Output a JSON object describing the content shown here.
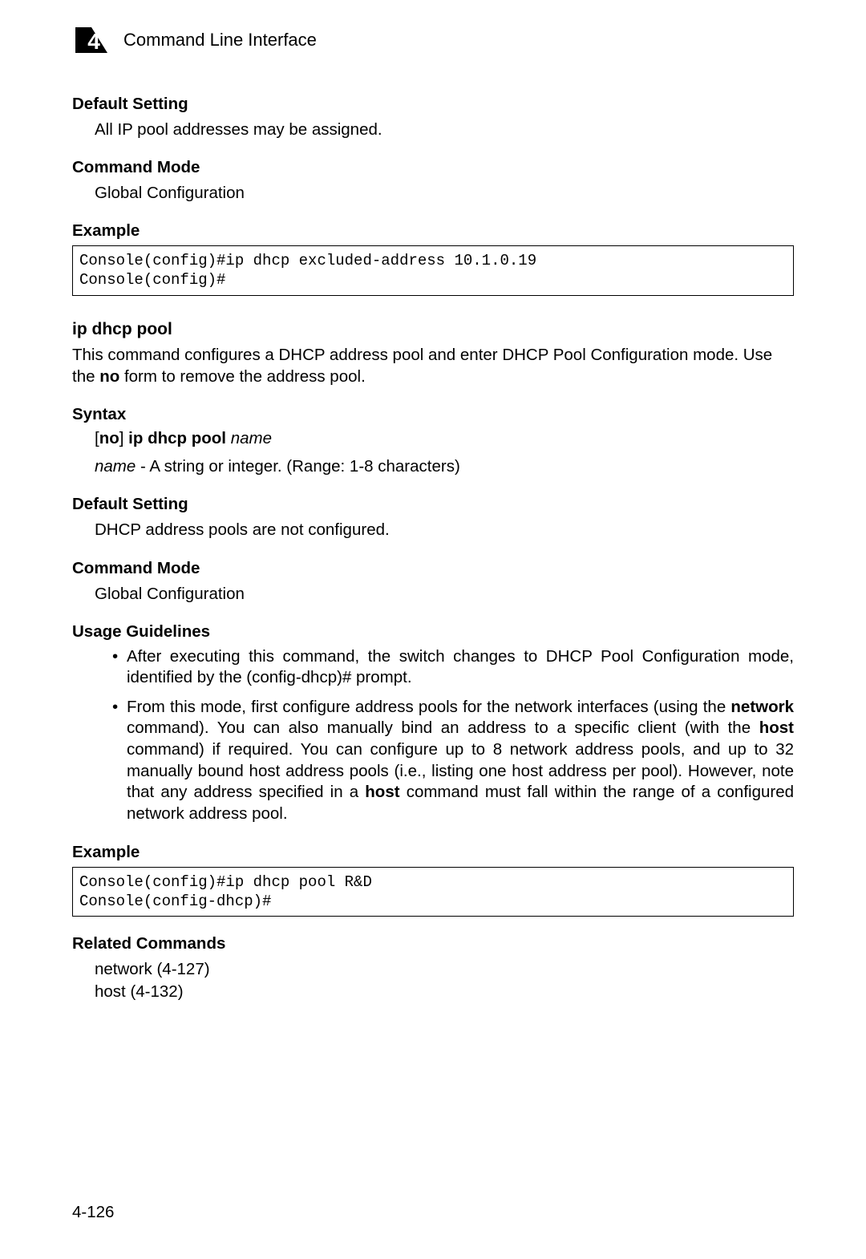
{
  "header": {
    "chapter_number": "4",
    "title": "Command Line Interface"
  },
  "sections": {
    "default_setting_1": {
      "heading": "Default Setting",
      "text": "All IP pool addresses may be assigned."
    },
    "command_mode_1": {
      "heading": "Command Mode",
      "text": "Global Configuration"
    },
    "example_1": {
      "heading": "Example",
      "code": "Console(config)#ip dhcp excluded-address 10.1.0.19\nConsole(config)#"
    },
    "command": {
      "title": "ip dhcp pool",
      "description": "This command configures a DHCP address pool and enter DHCP Pool Configuration mode. Use the ",
      "description_bold": "no",
      "description_after": " form to remove the address pool."
    },
    "syntax": {
      "heading": "Syntax",
      "prefix_bracket_open": "[",
      "prefix_bold": "no",
      "prefix_bracket_close": "] ",
      "cmd_bold": "ip dhcp pool",
      "param_italic": " name",
      "param_name_italic": "name",
      "param_desc": " - A string or integer. (Range: 1-8 characters)"
    },
    "default_setting_2": {
      "heading": "Default Setting",
      "text": "DHCP address pools are not configured."
    },
    "command_mode_2": {
      "heading": "Command Mode",
      "text": "Global Configuration"
    },
    "usage": {
      "heading": "Usage Guidelines",
      "items": [
        {
          "pre": "After executing this command, the switch changes to DHCP Pool Configuration mode, identified by the (config-dhcp)# prompt."
        },
        {
          "parts": [
            {
              "t": "From this mode, first configure address pools for the network interfaces (using the "
            },
            {
              "b": "network"
            },
            {
              "t": " command). You can also manually bind an address to a specific client (with the "
            },
            {
              "b": "host"
            },
            {
              "t": " command) if required. You can configure up to 8 network address pools, and up to 32 manually bound host address pools (i.e., listing one host address per pool). However, note that any address specified in a "
            },
            {
              "b": "host"
            },
            {
              "t": " command must fall within the range of a configured network address pool."
            }
          ]
        }
      ]
    },
    "example_2": {
      "heading": "Example",
      "code": "Console(config)#ip dhcp pool R&D\nConsole(config-dhcp)#"
    },
    "related": {
      "heading": "Related Commands",
      "items": [
        "network (4-127)",
        "host (4-132)"
      ]
    }
  },
  "page_number": "4-126"
}
